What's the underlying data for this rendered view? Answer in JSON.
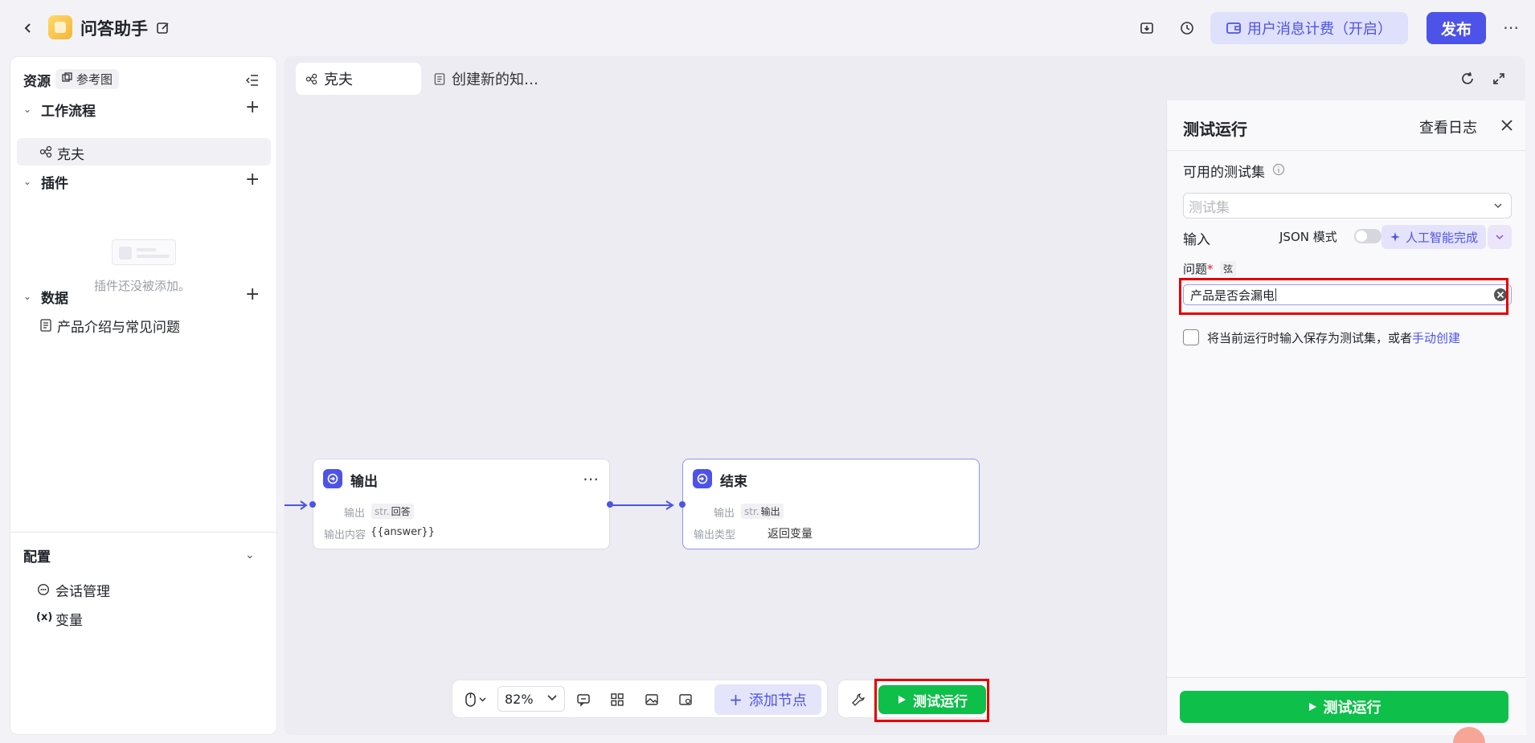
{
  "app": {
    "title": "问答助手",
    "billing_label": "用户消息计费（开启）",
    "publish_label": "发布"
  },
  "sidebar": {
    "title": "资源",
    "ref_chip": "参考图",
    "workflow_head": "工作流程",
    "workflow_item": "克夫",
    "plugin_head": "插件",
    "plugin_empty": "插件还没被添加。",
    "data_head": "数据",
    "data_item": "产品介绍与常见问题",
    "config_head": "配置",
    "config_items": [
      "会话管理",
      "变量"
    ]
  },
  "tabs": {
    "active": "克夫",
    "inactive": "创建新的知…"
  },
  "nodes": {
    "output": {
      "title": "输出",
      "row1_label": "输出",
      "row1_type": "str.",
      "row1_value": "回答",
      "row2_label": "输出内容",
      "row2_value": "{{answer}}"
    },
    "end": {
      "title": "结束",
      "row1_label": "输出",
      "row1_type": "str.",
      "row1_value": "输出",
      "row2_label": "输出类型",
      "row2_value": "返回变量"
    }
  },
  "toolbar": {
    "zoom": "82%",
    "add_node": "添加节点",
    "test_run": "测试运行"
  },
  "panel": {
    "title": "测试运行",
    "view_log": "查看日志",
    "testset_label": "可用的测试集",
    "testset_placeholder": "测试集",
    "input_label": "输入",
    "json_mode": "JSON 模式",
    "ai_complete": "人工智能完成",
    "question_label": "问题",
    "question_type": "弦",
    "question_value": "产品是否会漏电",
    "save_text": "将当前运行时输入保存为测试集，或者",
    "save_link": "手动创建",
    "run_label": "测试运行"
  },
  "colors": {
    "accent": "#4d53e8",
    "run_green": "#0ebf4a",
    "highlight": "#e30000"
  }
}
